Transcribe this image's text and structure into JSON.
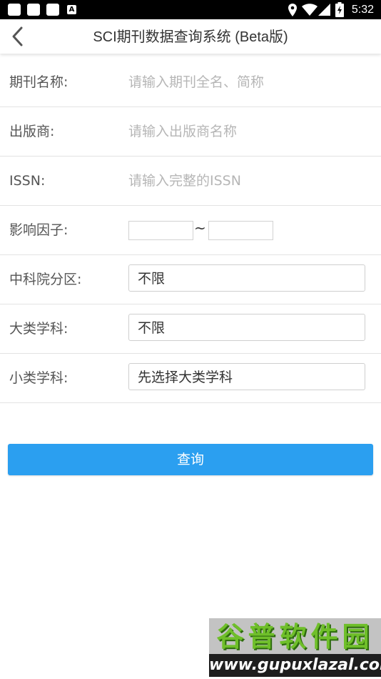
{
  "status_bar": {
    "time": "5:32",
    "notification_icon": "A"
  },
  "app_bar": {
    "title": "SCI期刊数据查询系统 (Beta版)"
  },
  "form": {
    "journal_name": {
      "label": "期刊名称:",
      "placeholder": "请输入期刊全名、简称"
    },
    "publisher": {
      "label": "出版商:",
      "placeholder": "请输入出版商名称"
    },
    "issn": {
      "label": "ISSN:",
      "placeholder": "请输入完整的ISSN"
    },
    "impact_factor": {
      "label": "影响因子:",
      "separator": "~"
    },
    "cas_zone": {
      "label": "中科院分区:",
      "value": "不限"
    },
    "major_subject": {
      "label": "大类学科:",
      "value": "不限"
    },
    "minor_subject": {
      "label": "小类学科:",
      "value": "先选择大类学科"
    }
  },
  "query_button": {
    "label": "查询"
  },
  "watermark": {
    "title": "谷普软件园",
    "url": "www.gupuxlazal.com"
  },
  "colors": {
    "accent": "#2b9ff0",
    "status_bar": "#000000",
    "watermark_green": "#6fbf2a"
  },
  "icons": [
    "location-icon",
    "wifi-icon",
    "signal-icon",
    "battery-charging-icon",
    "back-arrow-icon"
  ]
}
